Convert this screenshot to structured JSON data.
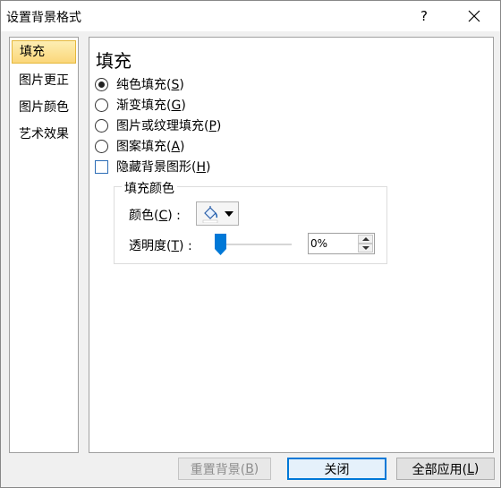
{
  "window": {
    "title": "设置背景格式",
    "help_label": "?"
  },
  "nav": {
    "items": [
      {
        "label": "填充"
      },
      {
        "label": "图片更正"
      },
      {
        "label": "图片颜色"
      },
      {
        "label": "艺术效果"
      }
    ],
    "selected": "填充"
  },
  "fill": {
    "heading": "填充",
    "options": [
      {
        "text": "纯色填充(",
        "key": "S",
        "close": ")"
      },
      {
        "text": "渐变填充(",
        "key": "G",
        "close": ")"
      },
      {
        "text": "图片或纹理填充(",
        "key": "P",
        "close": ")"
      },
      {
        "text": "图案填充(",
        "key": "A",
        "close": ")"
      }
    ],
    "selected_option": "纯色填充",
    "hide_background": {
      "text": "隐藏背景图形(",
      "key": "H",
      "close": ")",
      "checked": false
    },
    "color_group": {
      "title": "填充颜色",
      "color_label": {
        "text": "颜色(",
        "key": "C",
        "close": ") :"
      },
      "transparency_label": {
        "text": "透明度(",
        "key": "T",
        "close": ") :"
      },
      "transparency_value": "0%",
      "transparency_fraction": 0.0
    }
  },
  "buttons": {
    "reset": {
      "text": "重置背景(",
      "key": "B",
      "close": ")",
      "enabled": false
    },
    "close": "关闭",
    "apply_all": {
      "text": "全部应用(",
      "key": "L",
      "close": ")"
    }
  },
  "colors": {
    "accent": "#0078d7",
    "nav_selected": "#fbd77a",
    "slider_thumb": "#0078d7"
  }
}
